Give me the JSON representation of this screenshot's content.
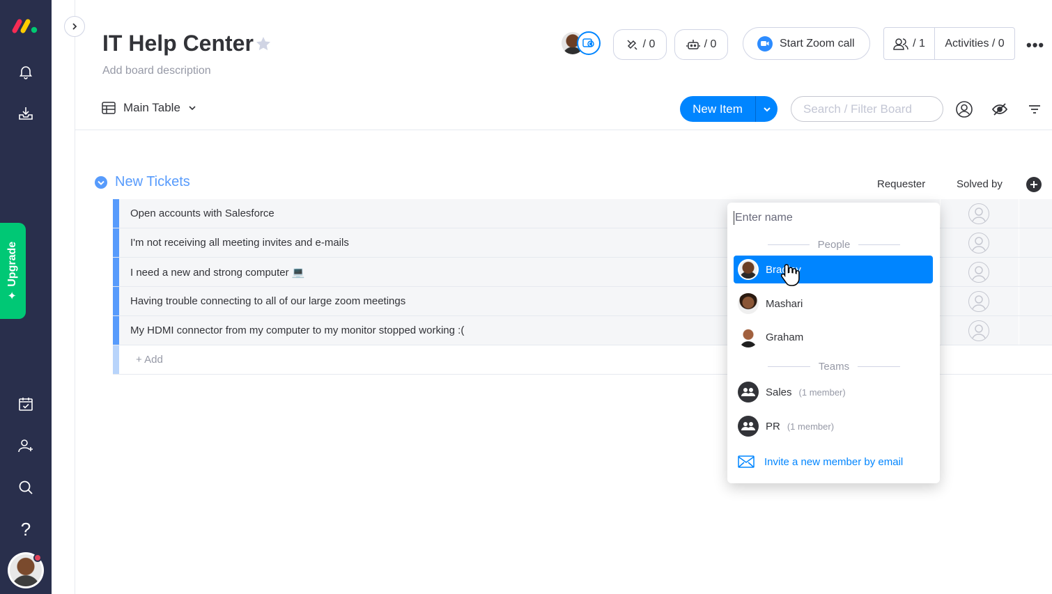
{
  "colors": {
    "rail_bg": "#292f4c",
    "accent": "#0085ff",
    "group": "#579bfc",
    "upgrade": "#00c875"
  },
  "rail": {
    "upgrade_label": "Upgrade",
    "icons": [
      "monday-logo-icon",
      "bell-icon",
      "inbox-download-icon",
      "calendar-check-icon",
      "invite-user-icon",
      "search-icon",
      "help-icon"
    ]
  },
  "board": {
    "title": "IT Help Center",
    "description": "Add board description",
    "updates_count": "/ 0",
    "automations_count": "/ 0",
    "zoom_label": "Start Zoom call",
    "members_count": "/ 1",
    "activities_label": "Activities / 0",
    "more_label": "•••"
  },
  "toolbar": {
    "view_label": "Main Table",
    "new_item_label": "New Item",
    "search_placeholder": "Search / Filter Board"
  },
  "group": {
    "title": "New Tickets",
    "columns": [
      "Requester",
      "Solved by"
    ],
    "items": [
      "Open accounts with Salesforce",
      "I'm not receiving all meeting invites and e-mails",
      "I need a new and strong computer 💻",
      "Having trouble connecting to all of our large zoom meetings",
      "My HDMI connector from my computer to my monitor stopped working :("
    ],
    "add_label": "+ Add"
  },
  "picker": {
    "input_placeholder": "Enter name",
    "people_label": "People",
    "people": [
      "Bradley",
      "Mashari",
      "Graham"
    ],
    "teams_label": "Teams",
    "teams": [
      {
        "name": "Sales",
        "sub": "(1 member)"
      },
      {
        "name": "PR",
        "sub": "(1 member)"
      }
    ],
    "invite_label": "Invite a new member by email"
  }
}
